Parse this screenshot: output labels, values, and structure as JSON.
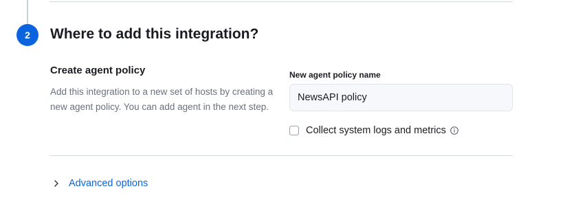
{
  "step": {
    "number": "2",
    "title": "Where to add this integration?"
  },
  "policy_section": {
    "title": "Create agent policy",
    "description": "Add this integration to a new set of hosts by creating a new agent policy. You can add agent in the next step."
  },
  "policy_name_field": {
    "label": "New agent policy name",
    "value": "NewsAPI policy"
  },
  "collect_system": {
    "label": "Collect system logs and metrics",
    "checked": false,
    "info_icon": "info-icon"
  },
  "advanced": {
    "label": "Advanced options",
    "icon": "chevron-right-icon",
    "expanded": false
  },
  "colors": {
    "accent": "#0b64dd",
    "text": "#1a1c21",
    "subdued_text": "#69707d",
    "divider": "#d3dae6",
    "field_bg": "#f7f8fc"
  }
}
